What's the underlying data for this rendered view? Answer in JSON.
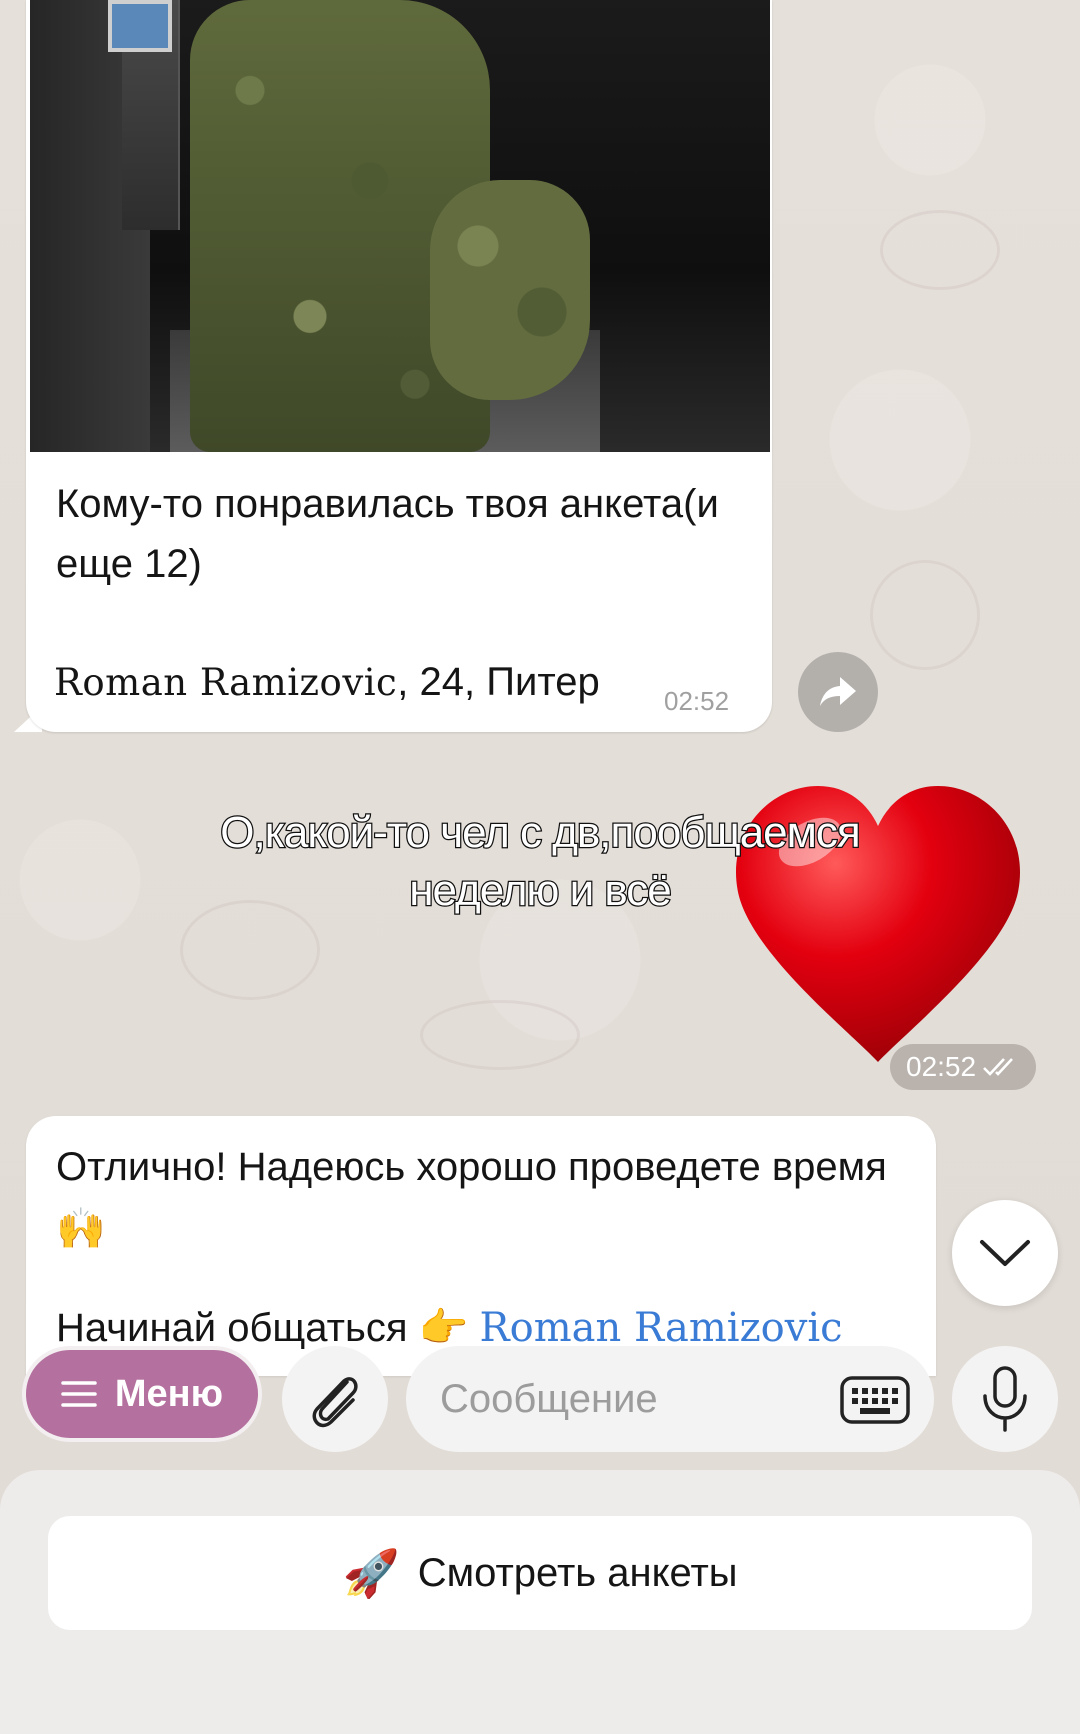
{
  "incoming_card": {
    "text": "Кому-то понравилась твоя анкета(и еще 12)",
    "name": "Roman Ramizovic",
    "details": ", 24, Питер",
    "time": "02:52"
  },
  "sticker": {
    "emoji": "heart",
    "time": "02:52",
    "status": "read-double-check"
  },
  "caption": {
    "line1": "О,какой-то чел с дв,пообщаемся",
    "line2": "неделю и всё"
  },
  "incoming_reply": {
    "text": "Отлично! Надеюсь хорошо проведете время 🙌",
    "cut_prefix": "Начинай общаться 👉 ",
    "cut_link": "Roman Ramizovic"
  },
  "composer": {
    "menu_label": "Меню",
    "placeholder": "Сообщение"
  },
  "bot_keyboard": {
    "button_emoji": "🚀",
    "button_label": "Смотреть анкеты"
  },
  "colors": {
    "menu": "#b4709e",
    "heart": "#e3000f",
    "link": "#3a7bd5"
  }
}
